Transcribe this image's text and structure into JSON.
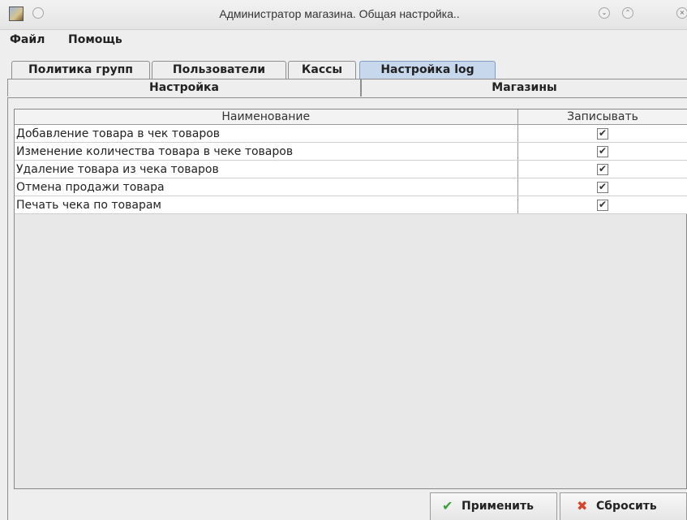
{
  "window": {
    "title": "Администратор магазина. Общая настройка..",
    "app_icon": "app-icon",
    "controls": [
      "minimize-icon",
      "maximize-icon",
      "close-icon"
    ]
  },
  "menu": {
    "items": [
      "Файл",
      "Помощь"
    ]
  },
  "tabs_top": {
    "items": [
      "Политика групп",
      "Пользователи",
      "Кассы",
      "Настройка log"
    ],
    "selected": "Настройка log"
  },
  "tabs_sub": {
    "items": [
      "Настройка",
      "Магазины"
    ],
    "selected": "Настройка"
  },
  "table": {
    "columns": [
      "Наименование",
      "Записывать"
    ],
    "rows": [
      {
        "name": "Добавление товара в чек товаров",
        "checked": true
      },
      {
        "name": "Изменение количества товара в чеке товаров",
        "checked": true
      },
      {
        "name": "Удаление товара из чека товаров",
        "checked": true
      },
      {
        "name": "Отмена продажи товара",
        "checked": true
      },
      {
        "name": "Печать чека по товарам",
        "checked": true
      }
    ]
  },
  "buttons": {
    "apply_label": "Применить",
    "apply_icon": "checkmark-icon",
    "reset_label": "Сбросить",
    "reset_icon": "red-x-icon"
  },
  "colors": {
    "selected_tab": "#c7d7ec",
    "apply_icon": "#3aa03a",
    "reset_icon": "#d6452b"
  }
}
